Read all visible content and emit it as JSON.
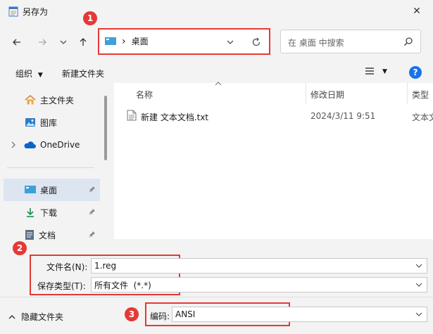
{
  "window": {
    "title": "另存为",
    "close_glyph": "✕"
  },
  "address": {
    "location": "桌面",
    "separator": "›"
  },
  "search": {
    "placeholder": "在 桌面 中搜索"
  },
  "toolbar": {
    "organize": "组织",
    "new_folder": "新建文件夹",
    "help": "?"
  },
  "sidebar": {
    "items": [
      {
        "label": "主文件夹",
        "icon": "home-icon"
      },
      {
        "label": "图库",
        "icon": "gallery-icon"
      },
      {
        "label": "OneDrive",
        "icon": "cloud-icon"
      },
      {
        "label": "桌面",
        "icon": "desktop-icon",
        "selected": true,
        "pinned": true
      },
      {
        "label": "下载",
        "icon": "download-icon",
        "pinned": true
      },
      {
        "label": "文档",
        "icon": "document-icon",
        "pinned": true
      }
    ]
  },
  "columns": {
    "name": "名称",
    "modified": "修改日期",
    "type": "类型"
  },
  "files": [
    {
      "name": "新建 文本文档.txt",
      "modified": "2024/3/11 9:51",
      "type": "文本文"
    }
  ],
  "form": {
    "filename_label": "文件名(N):",
    "filename_value": "1.reg",
    "filetype_label": "保存类型(T):",
    "filetype_value": "所有文件  (*.*)",
    "encoding_label": "编码:",
    "encoding_value": "ANSI"
  },
  "footer": {
    "hide_folders": "隐藏文件夹"
  },
  "annotations": [
    "1",
    "2",
    "3"
  ],
  "colors": {
    "highlight": "#e53935",
    "accent": "#1a73e8",
    "selected": "#dde6f0"
  }
}
